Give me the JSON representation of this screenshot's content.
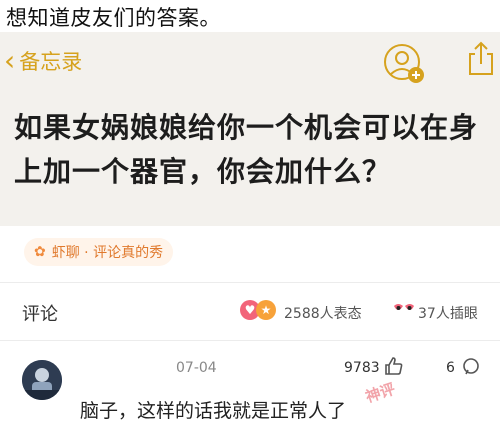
{
  "caption": "想知道皮友们的答案。",
  "memo": {
    "back_label": "备忘录",
    "title": "如果女娲娘娘给你一个机会可以在身上加一个器官，你会加什么？"
  },
  "topic": {
    "label": "虾聊 · 评论真的秀"
  },
  "comments": {
    "label": "评论",
    "reactions": "2588人表态",
    "stickers": "37人插眼"
  },
  "comment": {
    "date": "07-04",
    "likes": "9783",
    "replies": "6",
    "text": "脑子，这样的话我就是正常人了",
    "stamp": "神评"
  },
  "colors": {
    "accent": "#d6a21e",
    "memo_bg": "#f3f1ed",
    "topic_text": "#e0792c"
  }
}
